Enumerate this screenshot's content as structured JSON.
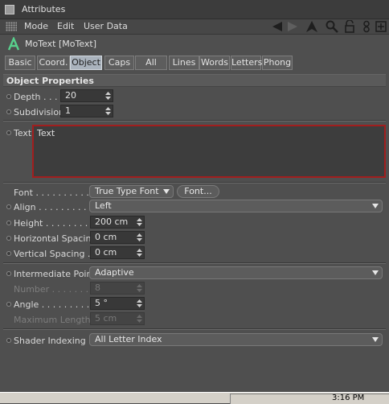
{
  "window": {
    "title": "Attributes"
  },
  "menu": {
    "mode": "Mode",
    "edit": "Edit",
    "user_data": "User Data"
  },
  "object": {
    "name": "MoText [MoText]"
  },
  "tabs": [
    {
      "label": "Basic",
      "active": false
    },
    {
      "label": "Coord.",
      "active": false
    },
    {
      "label": "Object",
      "active": true
    },
    {
      "label": "Caps",
      "active": false
    },
    {
      "label": "All",
      "active": false
    },
    {
      "label": "Lines",
      "active": false
    },
    {
      "label": "Words",
      "active": false
    },
    {
      "label": "Letters",
      "active": false
    },
    {
      "label": "Phong",
      "active": false
    }
  ],
  "section_title": "Object Properties",
  "props": {
    "depth": {
      "label": "Depth . . . .",
      "value": "20"
    },
    "subdivision": {
      "label": "Subdivision",
      "value": "1"
    },
    "text": {
      "label": "Text",
      "value": "Text"
    },
    "font": {
      "label": "Font . . . . . . . . . . .",
      "value": "True Type Font",
      "button": "Font..."
    },
    "align": {
      "label": "Align . . . . . . . . . . .",
      "value": "Left"
    },
    "height": {
      "label": "Height . . . . . . . . .",
      "value": "200 cm"
    },
    "h_spacing": {
      "label": "Horizontal Spacing",
      "value": "0 cm"
    },
    "v_spacing": {
      "label": "Vertical Spacing . .",
      "value": "0 cm"
    },
    "intermediate": {
      "label": "Intermediate Points",
      "value": "Adaptive"
    },
    "number": {
      "label": "Number . . . . . . . . .",
      "value": "8"
    },
    "angle": {
      "label": "Angle . . . . . . . . . .",
      "value": "5 °"
    },
    "max_length": {
      "label": "Maximum Length",
      "value": "5 cm"
    },
    "shader_indexing": {
      "label": "Shader Indexing . .",
      "value": "All Letter Index"
    }
  },
  "taskbar": {
    "clock": "3:16 PM"
  },
  "colors": {
    "accent_tab": "#aab3bd",
    "text_border": "#a11e1e"
  }
}
